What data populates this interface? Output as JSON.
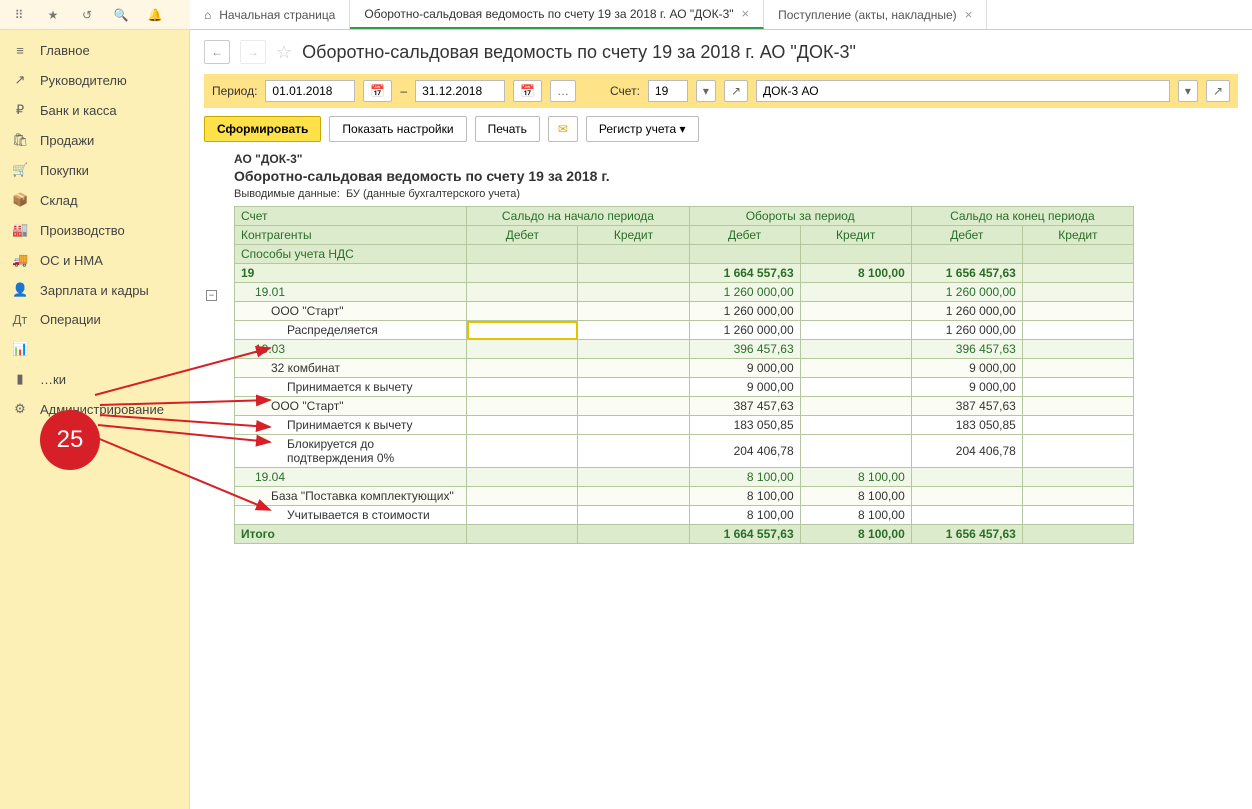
{
  "topbar_icons": [
    "apps",
    "star",
    "history",
    "search",
    "bell"
  ],
  "tabs": [
    {
      "label": "Начальная страница",
      "active": false,
      "home": true
    },
    {
      "label": "Оборотно-сальдовая ведомость по счету 19 за 2018 г. АО \"ДОК-3\"",
      "active": true,
      "closable": true
    },
    {
      "label": "Поступление (акты, накладные)",
      "active": false,
      "closable": true
    }
  ],
  "sidebar": [
    {
      "icon": "≡",
      "label": "Главное"
    },
    {
      "icon": "↗",
      "label": "Руководителю"
    },
    {
      "icon": "₽",
      "label": "Банк и касса"
    },
    {
      "icon": "🛍",
      "label": "Продажи"
    },
    {
      "icon": "🛒",
      "label": "Покупки"
    },
    {
      "icon": "📦",
      "label": "Склад"
    },
    {
      "icon": "🏭",
      "label": "Производство"
    },
    {
      "icon": "🚚",
      "label": "ОС и НМА"
    },
    {
      "icon": "👤",
      "label": "Зарплата и кадры"
    },
    {
      "icon": "Дт",
      "label": "Операции"
    },
    {
      "icon": "📊",
      "label": ""
    },
    {
      "icon": "▮",
      "label": "…ки"
    },
    {
      "icon": "⚙",
      "label": "Администрирование"
    }
  ],
  "badge": "25",
  "page_title": "Оборотно-сальдовая ведомость по счету 19 за 2018 г. АО \"ДОК-3\"",
  "filter": {
    "period_label": "Период:",
    "from": "01.01.2018",
    "to": "31.12.2018",
    "dash": "–",
    "account_label": "Счет:",
    "account": "19",
    "org": "ДОК-3 АО"
  },
  "actions": {
    "form": "Сформировать",
    "settings": "Показать настройки",
    "print": "Печать",
    "register": "Регистр учета"
  },
  "report": {
    "org": "АО \"ДОК-3\"",
    "title": "Оборотно-сальдовая ведомость по счету 19 за 2018 г.",
    "note_label": "Выводимые данные:",
    "note_val": "БУ (данные бухгалтерского учета)",
    "headers": {
      "c1": "Счет",
      "sub1": "Контрагенты",
      "sub2": "Способы учета НДС",
      "g1": "Сальдо на начало периода",
      "g2": "Обороты за период",
      "g3": "Сальдо на конец периода",
      "d": "Дебет",
      "k": "Кредит"
    },
    "rows": [
      {
        "lvl": 0,
        "label": "19",
        "d2": "1 664 557,63",
        "k2": "8 100,00",
        "d3": "1 656 457,63"
      },
      {
        "lvl": 1,
        "label": "19.01",
        "d2": "1 260 000,00",
        "d3": "1 260 000,00"
      },
      {
        "lvl": 2,
        "label": "ООО \"Старт\"",
        "d2": "1 260 000,00",
        "d3": "1 260 000,00"
      },
      {
        "lvl": 3,
        "label": "Распределяется",
        "d2": "1 260 000,00",
        "d3": "1 260 000,00",
        "sel": true
      },
      {
        "lvl": 1,
        "label": "19.03",
        "d2": "396 457,63",
        "d3": "396 457,63"
      },
      {
        "lvl": 2,
        "label": "32 комбинат",
        "d2": "9 000,00",
        "d3": "9 000,00"
      },
      {
        "lvl": 3,
        "label": "Принимается к вычету",
        "d2": "9 000,00",
        "d3": "9 000,00"
      },
      {
        "lvl": 2,
        "label": "ООО \"Старт\"",
        "d2": "387 457,63",
        "d3": "387 457,63"
      },
      {
        "lvl": 3,
        "label": "Принимается к вычету",
        "d2": "183 050,85",
        "d3": "183 050,85"
      },
      {
        "lvl": 3,
        "label": "Блокируется до подтверждения 0%",
        "d2": "204 406,78",
        "d3": "204 406,78"
      },
      {
        "lvl": 1,
        "label": "19.04",
        "d2": "8 100,00",
        "k2": "8 100,00"
      },
      {
        "lvl": 2,
        "label": "База \"Поставка комплектующих\"",
        "d2": "8 100,00",
        "k2": "8 100,00"
      },
      {
        "lvl": 3,
        "label": "Учитывается в стоимости",
        "d2": "8 100,00",
        "k2": "8 100,00"
      }
    ],
    "total": {
      "label": "Итого",
      "d2": "1 664 557,63",
      "k2": "8 100,00",
      "d3": "1 656 457,63"
    }
  }
}
